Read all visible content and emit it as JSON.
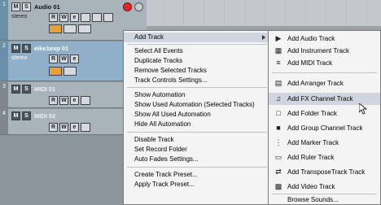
{
  "tracks": [
    {
      "number": "1",
      "name": "Audio 01",
      "sub": "stereo"
    },
    {
      "number": "2",
      "name": "eike1exp 01",
      "sub": "stereo"
    },
    {
      "number": "3",
      "name": "MIDI 01",
      "sub": ""
    },
    {
      "number": "4",
      "name": "MIDI 02",
      "sub": ""
    }
  ],
  "track_buttons": {
    "mute": "M",
    "solo": "S",
    "read": "R",
    "write": "W",
    "edit": "e"
  },
  "context_menu": {
    "items": [
      "Add Track",
      "Select All Events",
      "Duplicate Tracks",
      "Remove Selected Tracks",
      "Track Controls Settings...",
      "Show Automation",
      "Show Used Automation (Selected Tracks)",
      "Show All Used Automation",
      "Hide All Automation",
      "Disable Track",
      "Set Record Folder",
      "Auto Fades Settings...",
      "Create Track Preset...",
      "Apply Track Preset..."
    ]
  },
  "submenu": {
    "items": [
      {
        "label": "Add Audio Track",
        "icon": "audio-track-icon"
      },
      {
        "label": "Add Instrument Track",
        "icon": "instrument-track-icon"
      },
      {
        "label": "Add MIDI Track",
        "icon": "midi-track-icon"
      },
      {
        "label": "Add Arranger Track",
        "icon": "arranger-track-icon"
      },
      {
        "label": "Add FX Channel Track",
        "icon": "fx-channel-track-icon"
      },
      {
        "label": "Add Folder Track",
        "icon": "folder-track-icon"
      },
      {
        "label": "Add Group Channel Track",
        "icon": "group-channel-track-icon"
      },
      {
        "label": "Add Marker Track",
        "icon": "marker-track-icon"
      },
      {
        "label": "Add Ruler Track",
        "icon": "ruler-track-icon"
      },
      {
        "label": "Add TransposeTrack Track",
        "icon": "transpose-track-icon"
      },
      {
        "label": "Add Video Track",
        "icon": "video-track-icon"
      },
      {
        "label": "Browse Sounds...",
        "icon": ""
      }
    ]
  }
}
